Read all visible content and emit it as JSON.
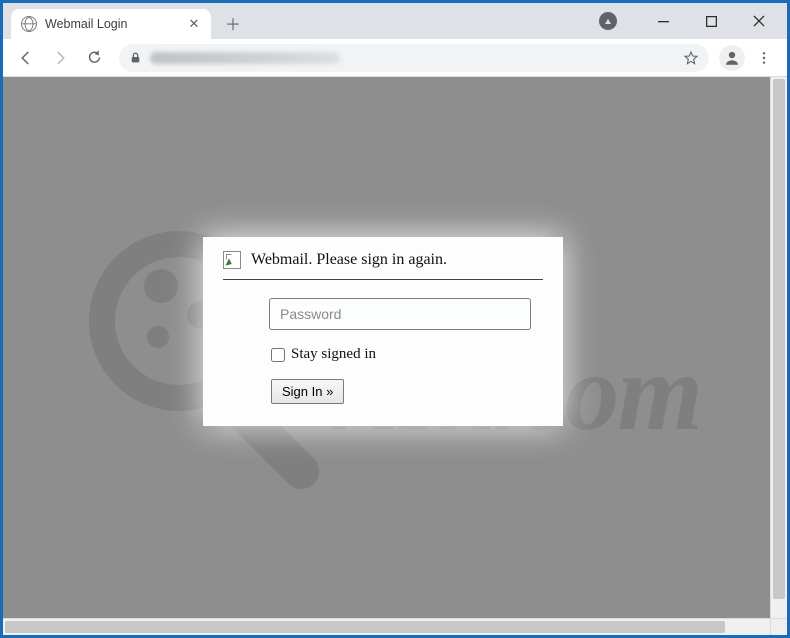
{
  "browser": {
    "tab_title": "Webmail Login"
  },
  "login": {
    "header": "Webmail. Please sign in again.",
    "password_placeholder": "Password",
    "password_value": "",
    "stay_label": "Stay signed in",
    "signin_label": "Sign In   »"
  }
}
